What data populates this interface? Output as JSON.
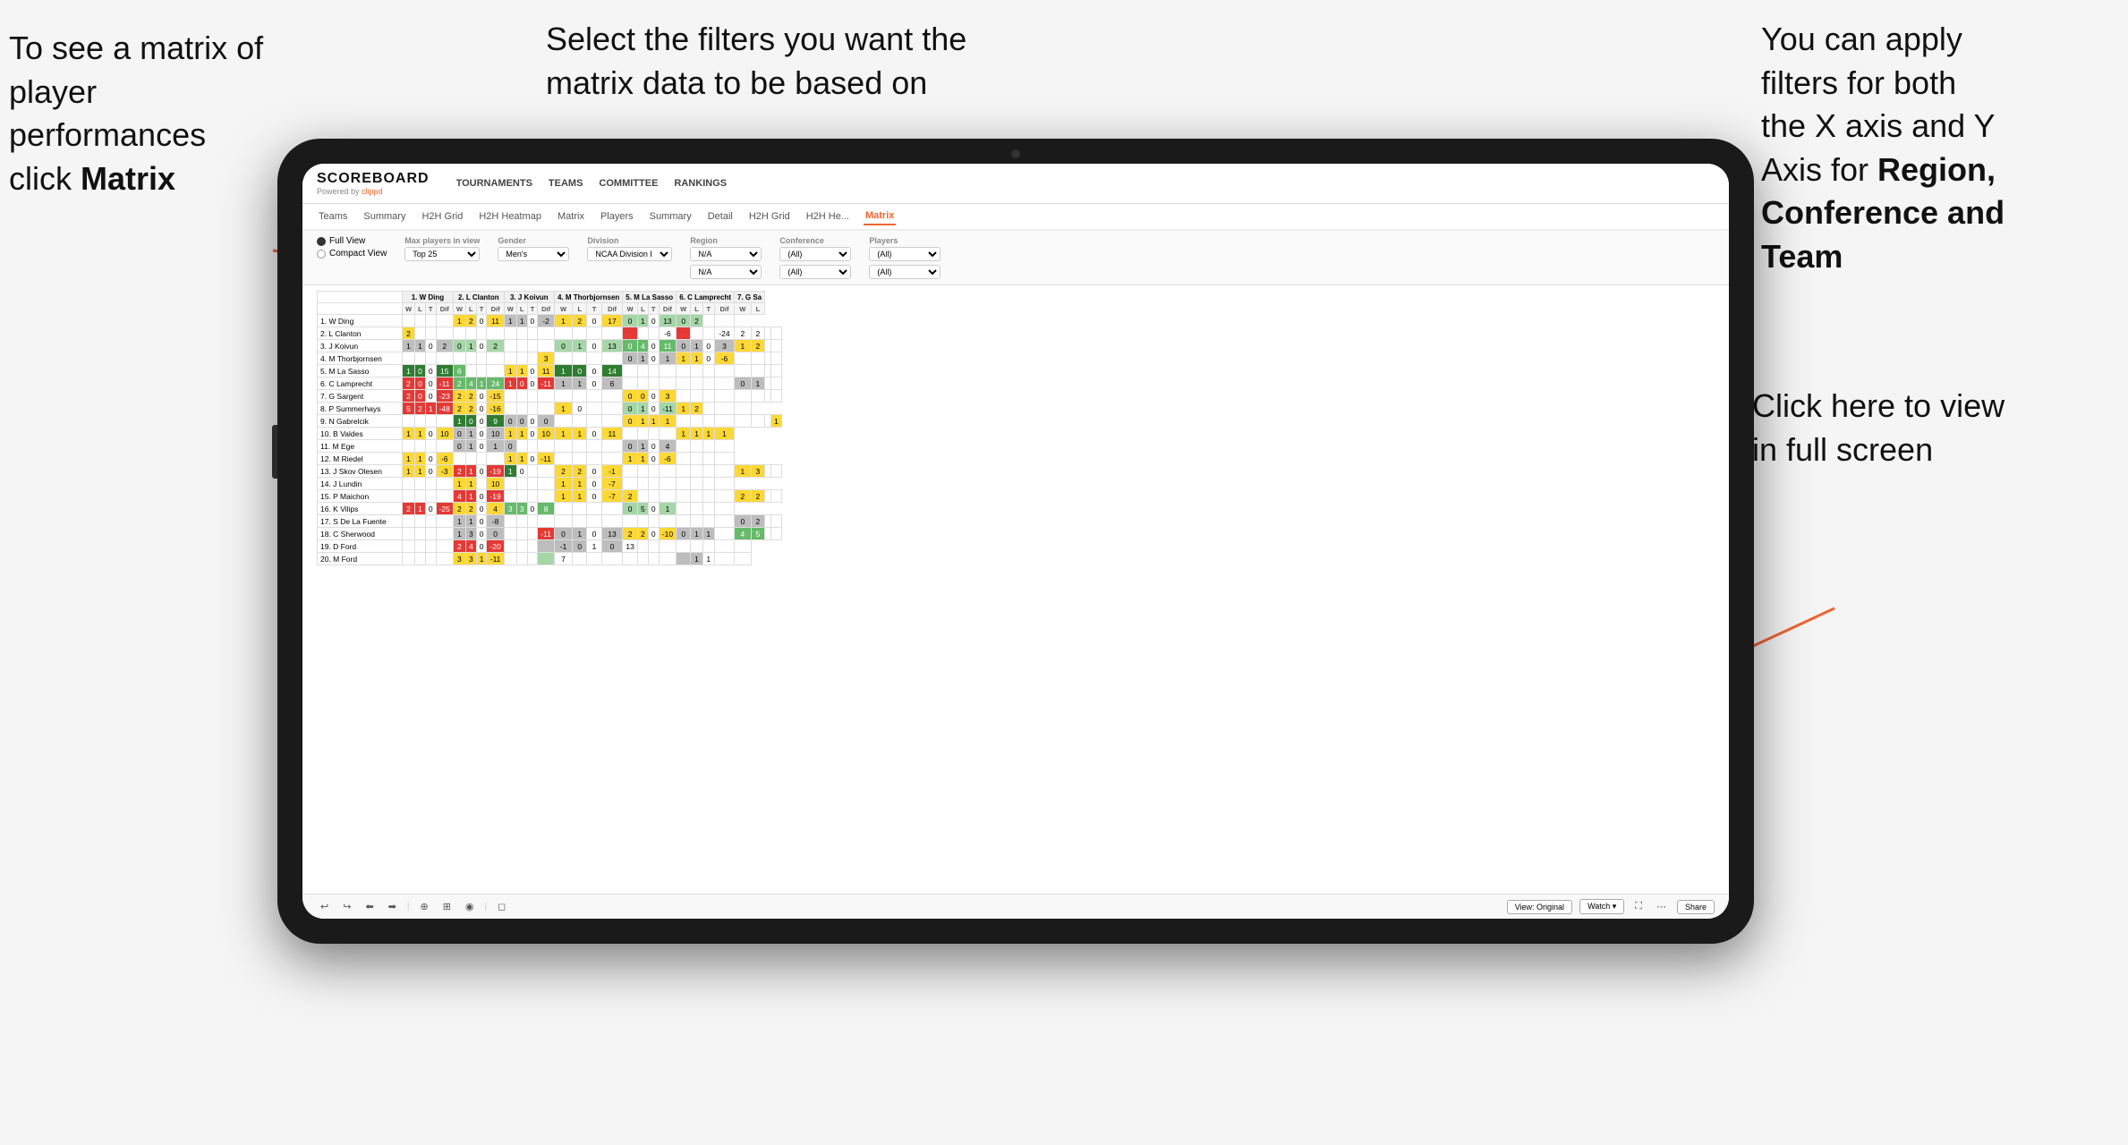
{
  "annotations": {
    "left": {
      "line1": "To see a matrix of",
      "line2": "player performances",
      "line3": "click ",
      "line3bold": "Matrix"
    },
    "center": {
      "text": "Select the filters you want the matrix data to be based on"
    },
    "right": {
      "line1": "You  can apply",
      "line2": "filters for both",
      "line3": "the X axis and Y",
      "line4": "Axis for ",
      "line4bold": "Region,",
      "line5bold": "Conference and",
      "line6bold": "Team"
    },
    "bottomRight": {
      "line1": "Click here to view",
      "line2": "in full screen"
    }
  },
  "app": {
    "logo": {
      "name": "SCOREBOARD",
      "powered": "Powered by clippd"
    },
    "topNav": [
      "TOURNAMENTS",
      "TEAMS",
      "COMMITTEE",
      "RANKINGS"
    ],
    "subNav": [
      "Teams",
      "Summary",
      "H2H Grid",
      "H2H Heatmap",
      "Matrix",
      "Players",
      "Summary",
      "Detail",
      "H2H Grid",
      "H2H He...",
      "Matrix"
    ],
    "activeSubNav": "Matrix",
    "filters": {
      "viewOptions": [
        "Full View",
        "Compact View"
      ],
      "selectedView": "Full View",
      "maxPlayers": {
        "label": "Max players in view",
        "value": "Top 25"
      },
      "gender": {
        "label": "Gender",
        "value": "Men's"
      },
      "division": {
        "label": "Division",
        "value": "NCAA Division I"
      },
      "region": {
        "label": "Region",
        "value": "N/A",
        "value2": "N/A"
      },
      "conference": {
        "label": "Conference",
        "value": "(All)",
        "value2": "(All)"
      },
      "players": {
        "label": "Players",
        "value": "(All)",
        "value2": "(All)"
      }
    },
    "matrix": {
      "columnGroups": [
        "1. W Ding",
        "2. L Clanton",
        "3. J Koivun",
        "4. M Thorbjornsen",
        "5. M La Sasso",
        "6. C Lamprecht",
        "7. G Sa"
      ],
      "subHeaders": [
        "W",
        "L",
        "T",
        "Dif"
      ],
      "rows": [
        {
          "name": "1. W Ding",
          "cells": [
            "self",
            "self",
            "self",
            "self",
            "1",
            "2",
            "0",
            "11",
            "1",
            "1",
            "0",
            "-2",
            "1",
            "2",
            "0",
            "17",
            "0",
            "1",
            "0",
            "13",
            "0",
            "2",
            "",
            ""
          ]
        },
        {
          "name": "2. L Clanton",
          "cells": [
            "2",
            "",
            "",
            "",
            "self",
            "self",
            "self",
            "self",
            "",
            "",
            "",
            "",
            "",
            "",
            "",
            "",
            "",
            "",
            "",
            "-6",
            "",
            "",
            "",
            "-24",
            "2",
            "2",
            "",
            ""
          ]
        },
        {
          "name": "3. J Koivun",
          "cells": [
            "1",
            "1",
            "0",
            "2",
            "0",
            "1",
            "0",
            "2",
            "self",
            "self",
            "self",
            "self",
            "0",
            "1",
            "0",
            "13",
            "0",
            "4",
            "0",
            "11",
            "0",
            "1",
            "0",
            "3",
            "1",
            "2",
            "",
            ""
          ]
        },
        {
          "name": "4. M Thorbjornsen",
          "cells": [
            "",
            "",
            "",
            "",
            "",
            "",
            "",
            "",
            "",
            "",
            "",
            "3",
            "self",
            "self",
            "self",
            "self",
            "0",
            "1",
            "0",
            "1",
            "1",
            "1",
            "0",
            "-6",
            "",
            "",
            "",
            ""
          ]
        },
        {
          "name": "5. M La Sasso",
          "cells": [
            "1",
            "0",
            "0",
            "15",
            "6",
            "",
            "",
            "",
            "1",
            "1",
            "0",
            "11",
            "1",
            "0",
            "0",
            "14",
            "self",
            "self",
            "self",
            "self",
            "",
            "",
            "",
            "",
            "",
            "",
            "",
            ""
          ]
        },
        {
          "name": "6. C Lamprecht",
          "cells": [
            "2",
            "0",
            "0",
            "-11",
            "2",
            "4",
            "1",
            "24",
            "1",
            "0",
            "0",
            "-11",
            "1",
            "1",
            "0",
            "6",
            "self",
            "self",
            "self",
            "self",
            "",
            "",
            "",
            "",
            "0",
            "1",
            "",
            ""
          ]
        },
        {
          "name": "7. G Sargent",
          "cells": [
            "2",
            "0",
            "0",
            "-23",
            "2",
            "2",
            "0",
            "-15",
            "",
            "",
            "",
            "",
            "",
            "",
            "",
            "",
            "0",
            "0",
            "0",
            "3",
            "self",
            "self",
            "self",
            "self",
            "",
            "",
            "",
            ""
          ]
        },
        {
          "name": "8. P Summerhays",
          "cells": [
            "5",
            "2",
            "1",
            "-48",
            "2",
            "2",
            "0",
            "-16",
            "",
            "",
            "",
            "",
            "1",
            "0",
            "",
            "",
            "0",
            "1",
            "0",
            "-11",
            "1",
            "2",
            "",
            "",
            ""
          ]
        },
        {
          "name": "9. N Gabrelcik",
          "cells": [
            "",
            "",
            "",
            "",
            "1",
            "0",
            "0",
            "9",
            "0",
            "0",
            "0",
            "0",
            "",
            "",
            "",
            "",
            "0",
            "1",
            "1",
            "1",
            "",
            "",
            "",
            "",
            "",
            "",
            "",
            "1"
          ]
        },
        {
          "name": "10. B Valdes",
          "cells": [
            "1",
            "1",
            "0",
            "10",
            "0",
            "1",
            "0",
            "10",
            "1",
            "1",
            "0",
            "10",
            "1",
            "1",
            "0",
            "11",
            "",
            "",
            "",
            "",
            "1",
            "1",
            "1",
            "1"
          ]
        },
        {
          "name": "11. M Ege",
          "cells": [
            "",
            "",
            "",
            "",
            "0",
            "1",
            "0",
            "1",
            "0",
            "",
            "",
            "",
            "",
            "",
            "",
            "",
            "0",
            "1",
            "0",
            "4",
            "",
            "",
            "",
            ""
          ]
        },
        {
          "name": "12. M Riedel",
          "cells": [
            "1",
            "1",
            "0",
            "-6",
            "",
            "",
            "",
            "",
            "1",
            "1",
            "0",
            "-11",
            "",
            "",
            "",
            "",
            "1",
            "1",
            "0",
            "-6",
            "",
            "",
            "",
            ""
          ]
        },
        {
          "name": "13. J Skov Olesen",
          "cells": [
            "1",
            "1",
            "0",
            "-3",
            "2",
            "1",
            "0",
            "-19",
            "1",
            "0",
            "",
            "",
            "2",
            "2",
            "0",
            "-1",
            "",
            "",
            "",
            "",
            "",
            "",
            "",
            "",
            "1",
            "3",
            "",
            ""
          ]
        },
        {
          "name": "14. J Lundin",
          "cells": [
            "",
            "",
            "",
            "",
            "1",
            "1",
            "",
            "10",
            "",
            "",
            "",
            "",
            "1",
            "1",
            "0",
            "-7",
            "",
            "",
            "",
            "",
            "",
            "",
            "",
            ""
          ]
        },
        {
          "name": "15. P Maichon",
          "cells": [
            "",
            "",
            "",
            "",
            "4",
            "1",
            "0",
            "-19",
            "",
            "",
            "",
            "",
            "1",
            "1",
            "0",
            "-7",
            "2",
            "",
            "",
            "",
            "",
            "",
            "",
            "",
            "2",
            "2",
            "",
            ""
          ]
        },
        {
          "name": "16. K Vilips",
          "cells": [
            "2",
            "1",
            "0",
            "-25",
            "2",
            "2",
            "0",
            "4",
            "3",
            "3",
            "0",
            "8",
            "",
            "",
            "",
            "",
            "0",
            "5",
            "0",
            "1",
            "",
            "",
            "",
            ""
          ]
        },
        {
          "name": "17. S De La Fuente",
          "cells": [
            "",
            "",
            "",
            "",
            "1",
            "1",
            "0",
            "-8",
            "",
            "",
            "",
            "",
            "",
            "",
            "",
            "",
            "",
            "",
            "",
            "",
            "",
            "",
            "",
            "",
            "0",
            "2",
            "",
            ""
          ]
        },
        {
          "name": "18. C Sherwood",
          "cells": [
            "",
            "",
            "",
            "",
            "1",
            "3",
            "0",
            "0",
            "",
            "",
            "",
            "-11",
            "0",
            "1",
            "0",
            "13",
            "2",
            "2",
            "0",
            "-10",
            "0",
            "1",
            "1",
            "",
            "4",
            "5",
            "",
            ""
          ]
        },
        {
          "name": "19. D Ford",
          "cells": [
            "",
            "",
            "",
            "",
            "2",
            "4",
            "0",
            "-20",
            "",
            "",
            "",
            "",
            "-1",
            "0",
            "1",
            "0",
            "13",
            "",
            "",
            "",
            "",
            "",
            "",
            "",
            ""
          ]
        },
        {
          "name": "20. M Ford",
          "cells": [
            "",
            "",
            "",
            "",
            "3",
            "3",
            "1",
            "-11",
            "",
            "",
            "",
            "",
            "7",
            "",
            "",
            "",
            "",
            "",
            "",
            "",
            "",
            "1",
            "1",
            "",
            ""
          ]
        }
      ]
    },
    "toolbar": {
      "buttons": [
        "↩",
        "↪",
        "⬅",
        "➡",
        "⊕",
        "⊞+",
        "◉",
        "◻"
      ],
      "viewOriginal": "View: Original",
      "watch": "Watch ▾",
      "share": "Share"
    }
  }
}
